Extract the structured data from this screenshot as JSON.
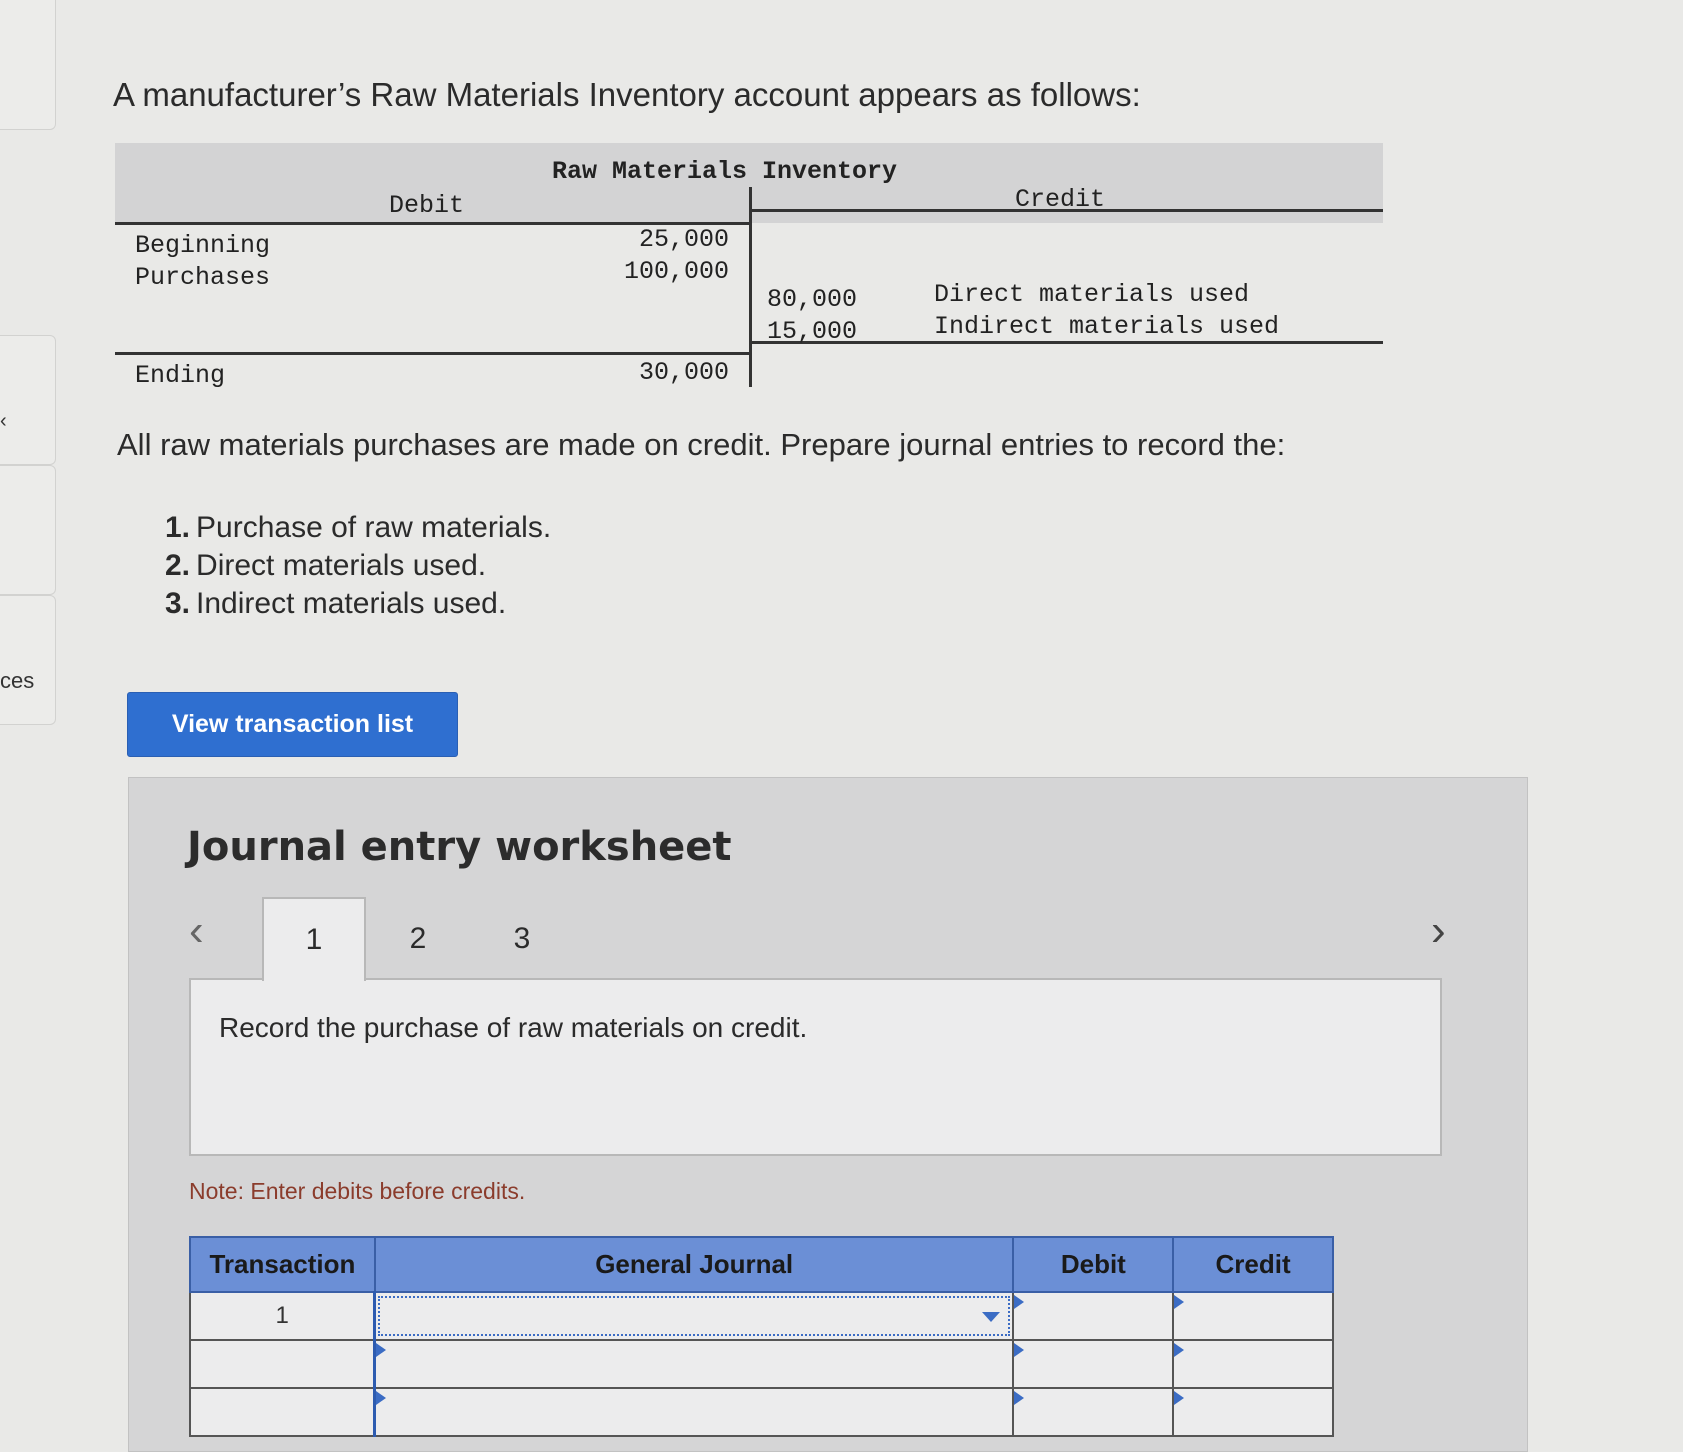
{
  "left_rail": {
    "label": "ces",
    "mark": "‹"
  },
  "question": {
    "title": "A manufacturer’s Raw Materials Inventory account appears as follows:",
    "intro": "All raw materials purchases are made on credit. Prepare journal entries to record the:",
    "requirements": [
      {
        "num": "1.",
        "text": "Purchase of raw materials."
      },
      {
        "num": "2.",
        "text": "Direct materials used."
      },
      {
        "num": "3.",
        "text": "Indirect materials used."
      }
    ]
  },
  "t_account": {
    "title": "Raw Materials Inventory",
    "debit_header": "Debit",
    "credit_header": "Credit",
    "beginning_label": "Beginning",
    "beginning_value": "25,000",
    "purchases_label": "Purchases",
    "purchases_value": "100,000",
    "direct_value": "80,000",
    "direct_label": "Direct materials used",
    "indirect_value": "15,000",
    "indirect_label": "Indirect materials used",
    "ending_label": "Ending",
    "ending_value": "30,000"
  },
  "buttons": {
    "view_transactions": "View transaction list"
  },
  "worksheet": {
    "title": "Journal entry worksheet",
    "tabs": [
      "1",
      "2",
      "3"
    ],
    "active_tab": "1",
    "prompt": "Record the purchase of raw materials on credit.",
    "note": "Note: Enter debits before credits.",
    "table": {
      "headers": {
        "transaction": "Transaction",
        "general_journal": "General Journal",
        "debit": "Debit",
        "credit": "Credit"
      },
      "rows": [
        {
          "transaction": "1",
          "account": "",
          "debit": "",
          "credit": ""
        },
        {
          "transaction": "",
          "account": "",
          "debit": "",
          "credit": ""
        },
        {
          "transaction": "",
          "account": "",
          "debit": "",
          "credit": ""
        }
      ]
    }
  },
  "colors": {
    "accent": "#2f6fd0",
    "table_header": "#6b8fd6",
    "note": "#8b3c2c"
  }
}
